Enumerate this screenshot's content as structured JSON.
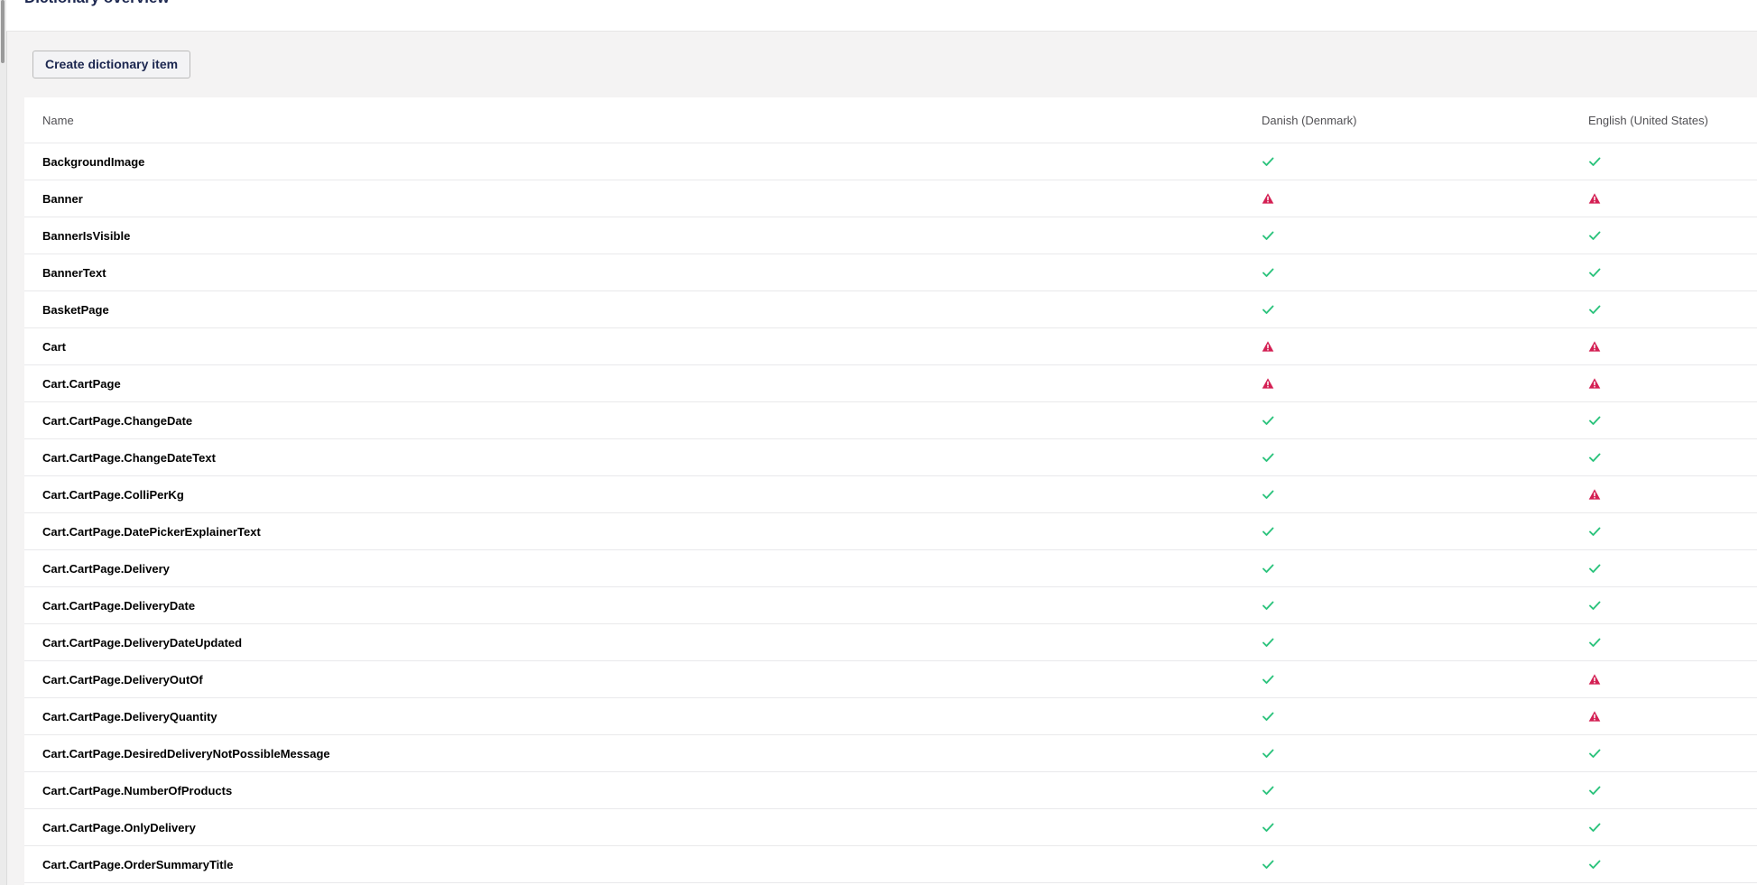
{
  "header": {
    "title": "Dictionary overview"
  },
  "toolbar": {
    "create_label": "Create dictionary item"
  },
  "table": {
    "columns": [
      "Name",
      "Danish (Denmark)",
      "English (United States)"
    ],
    "rows": [
      {
        "name": "BackgroundImage",
        "danish": "ok",
        "english": "ok"
      },
      {
        "name": "Banner",
        "danish": "warning",
        "english": "warning"
      },
      {
        "name": "BannerIsVisible",
        "danish": "ok",
        "english": "ok"
      },
      {
        "name": "BannerText",
        "danish": "ok",
        "english": "ok"
      },
      {
        "name": "BasketPage",
        "danish": "ok",
        "english": "ok"
      },
      {
        "name": "Cart",
        "danish": "warning",
        "english": "warning"
      },
      {
        "name": "Cart.CartPage",
        "danish": "warning",
        "english": "warning"
      },
      {
        "name": "Cart.CartPage.ChangeDate",
        "danish": "ok",
        "english": "ok"
      },
      {
        "name": "Cart.CartPage.ChangeDateText",
        "danish": "ok",
        "english": "ok"
      },
      {
        "name": "Cart.CartPage.ColliPerKg",
        "danish": "ok",
        "english": "warning"
      },
      {
        "name": "Cart.CartPage.DatePickerExplainerText",
        "danish": "ok",
        "english": "ok"
      },
      {
        "name": "Cart.CartPage.Delivery",
        "danish": "ok",
        "english": "ok"
      },
      {
        "name": "Cart.CartPage.DeliveryDate",
        "danish": "ok",
        "english": "ok"
      },
      {
        "name": "Cart.CartPage.DeliveryDateUpdated",
        "danish": "ok",
        "english": "ok"
      },
      {
        "name": "Cart.CartPage.DeliveryOutOf",
        "danish": "ok",
        "english": "warning"
      },
      {
        "name": "Cart.CartPage.DeliveryQuantity",
        "danish": "ok",
        "english": "warning"
      },
      {
        "name": "Cart.CartPage.DesiredDeliveryNotPossibleMessage",
        "danish": "ok",
        "english": "ok"
      },
      {
        "name": "Cart.CartPage.NumberOfProducts",
        "danish": "ok",
        "english": "ok"
      },
      {
        "name": "Cart.CartPage.OnlyDelivery",
        "danish": "ok",
        "english": "ok"
      },
      {
        "name": "Cart.CartPage.OrderSummaryTitle",
        "danish": "ok",
        "english": "ok"
      }
    ]
  },
  "icons": {
    "ok": "check-icon",
    "warning": "warning-icon"
  },
  "colors": {
    "ok": "#2bc37c",
    "warning": "#d42054",
    "text": "#1b264f"
  }
}
